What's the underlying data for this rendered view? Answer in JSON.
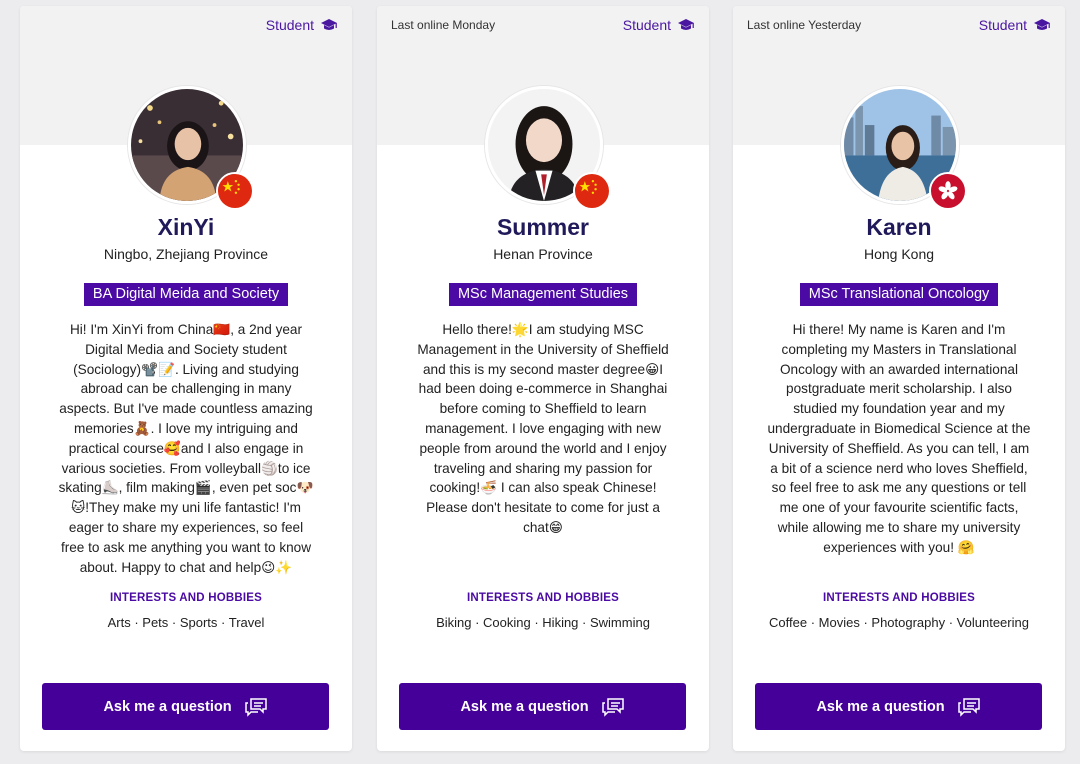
{
  "colors": {
    "accent": "#4a0aa3",
    "button": "#45009a",
    "name": "#201a5a",
    "header_bg": "#f2f2f3"
  },
  "cards": [
    {
      "last_online": "",
      "badge": "Student",
      "badge_icon": "graduation-cap-icon",
      "flag": "china-flag",
      "name": "XinYi",
      "location": "Ningbo, Zhejiang Province",
      "course": "BA Digital Meida and Society",
      "bio": "Hi! I'm XinYi from China🇨🇳, a 2nd year Digital Media and Society student (Sociology)📽️📝. Living and studying abroad can be challenging in many aspects. But I've made countless amazing memories🧸. I love my intriguing and practical course🥰and I also engage in various societies. From volleyball🏐to ice skating⛸️, film making🎬, even pet soc🐶🐱!They make my uni life fantastic! I'm eager to share my experiences, so feel free to ask me anything you want to know about. Happy to chat and help😉✨",
      "interests_title": "INTERESTS AND HOBBIES",
      "interests": "Arts · Pets · Sports · Travel",
      "button": "Ask me a question"
    },
    {
      "last_online": "Last online Monday",
      "badge": "Student",
      "badge_icon": "graduation-cap-icon",
      "flag": "china-flag",
      "name": "Summer",
      "location": "Henan Province",
      "course": "MSc Management Studies",
      "bio": "Hello there!🌟I am studying MSC Management in the University of Sheffield and this is my second master degree😀I had been doing e-commerce in Shanghai before coming to Sheffield to learn management. I love engaging with new people from around the world and I enjoy traveling and sharing my passion for cooking!🍜 I can also speak Chinese! Please don't hesitate to come for just a chat😁",
      "interests_title": "INTERESTS AND HOBBIES",
      "interests": "Biking · Cooking · Hiking · Swimming",
      "button": "Ask me a question"
    },
    {
      "last_online": "Last online Yesterday",
      "badge": "Student",
      "badge_icon": "graduation-cap-icon",
      "flag": "hong-kong-flag",
      "name": "Karen",
      "location": "Hong Kong",
      "course": "MSc Translational Oncology",
      "bio": "Hi there! My name is Karen and I'm completing my Masters in Translational Oncology with an awarded international postgraduate merit scholarship. I also studied my foundation year and my undergraduate in Biomedical Science at the University of Sheffield. As you can tell, I am a bit of a science nerd who loves Sheffield, so feel free to ask me any questions or tell me one of your favourite scientific facts, while allowing me to share my university experiences with you! 🤗",
      "interests_title": "INTERESTS AND HOBBIES",
      "interests": "Coffee · Movies · Photography · Volunteering",
      "button": "Ask me a question"
    }
  ]
}
